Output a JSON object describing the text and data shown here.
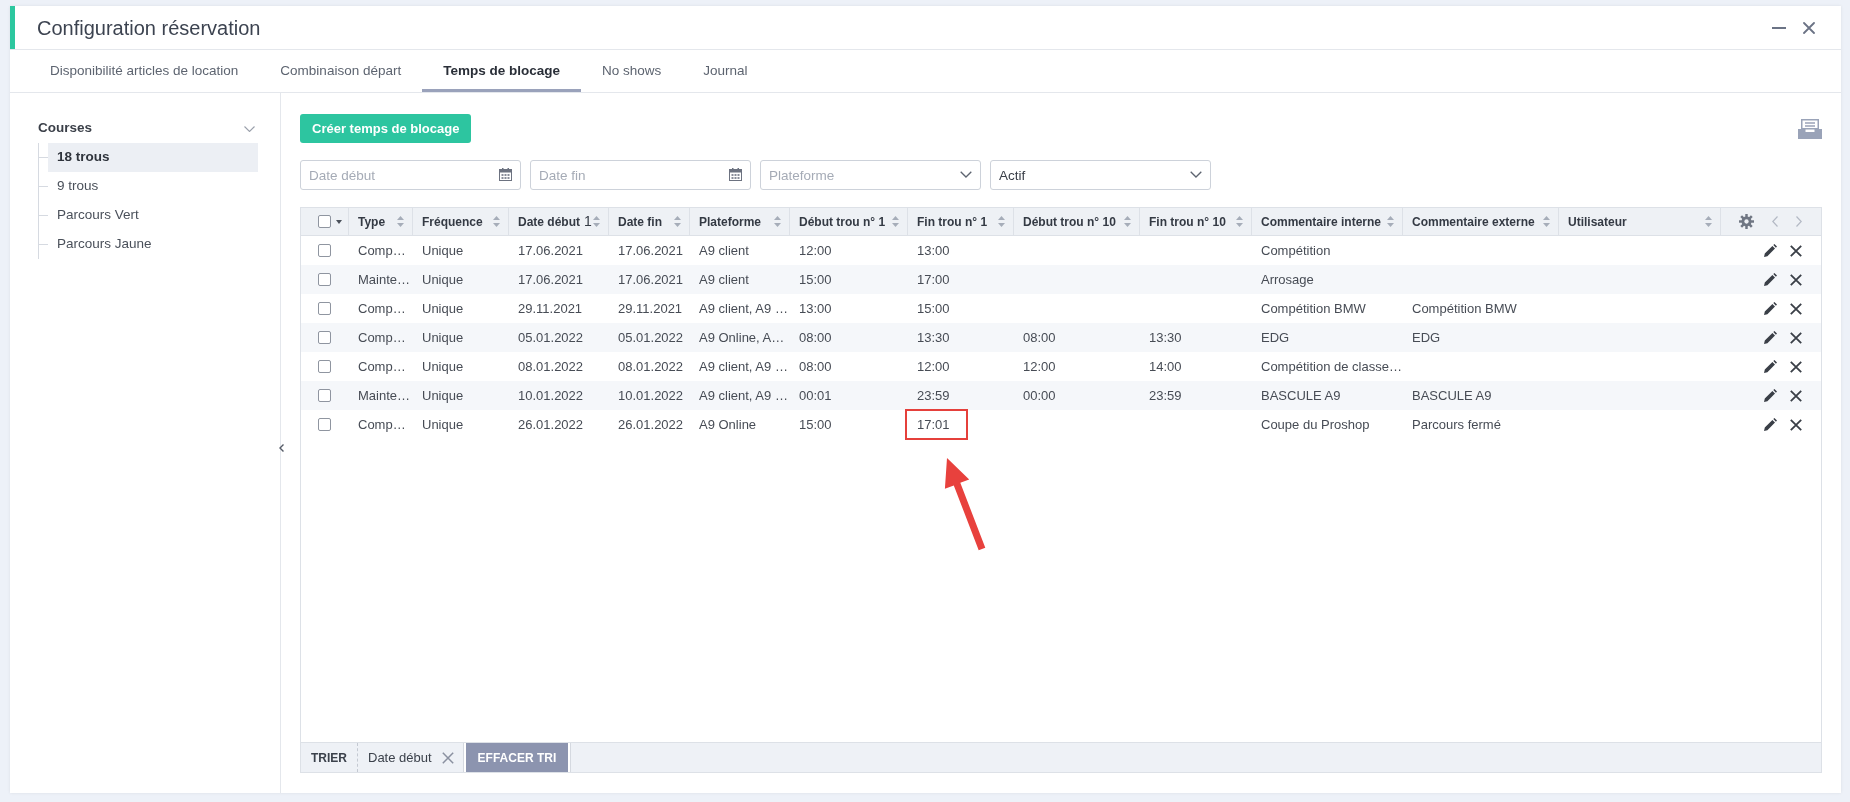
{
  "window": {
    "title": "Configuration réservation"
  },
  "tabs": [
    {
      "label": "Disponibilité articles de location",
      "selected": false
    },
    {
      "label": "Combinaison départ",
      "selected": false
    },
    {
      "label": "Temps de blocage",
      "selected": true
    },
    {
      "label": "No shows",
      "selected": false
    },
    {
      "label": "Journal",
      "selected": false
    }
  ],
  "sidebar": {
    "heading": "Courses",
    "expanded": true,
    "items": [
      {
        "label": "18 trous",
        "selected": true
      },
      {
        "label": "9 trous",
        "selected": false
      },
      {
        "label": "Parcours Vert",
        "selected": false
      },
      {
        "label": "Parcours Jaune",
        "selected": false
      }
    ]
  },
  "toolbar": {
    "create_button": "Créer temps de blocage"
  },
  "filters": [
    {
      "kind": "date",
      "placeholder": "Date début"
    },
    {
      "kind": "date",
      "placeholder": "Date fin"
    },
    {
      "kind": "select",
      "placeholder": "Plateforme"
    },
    {
      "kind": "select",
      "value": "Actif"
    }
  ],
  "table": {
    "select_all_checked": false,
    "columns": [
      {
        "label": "Type"
      },
      {
        "label": "Fréquence"
      },
      {
        "label": "Date début",
        "sort_order": "1"
      },
      {
        "label": "Date fin"
      },
      {
        "label": "Plateforme"
      },
      {
        "label": "Début trou n° 1"
      },
      {
        "label": "Fin trou n° 1"
      },
      {
        "label": "Début trou n° 10"
      },
      {
        "label": "Fin trou n° 10"
      },
      {
        "label": "Commentaire interne"
      },
      {
        "label": "Commentaire externe"
      },
      {
        "label": "Utilisateur"
      }
    ],
    "rows": [
      {
        "checked": false,
        "cells": [
          "Comp…",
          "Unique",
          "17.06.2021",
          "17.06.2021",
          "A9 client",
          "12:00",
          "13:00",
          null,
          null,
          "Compétition",
          null,
          null
        ]
      },
      {
        "checked": false,
        "cells": [
          "Mainte…",
          "Unique",
          "17.06.2021",
          "17.06.2021",
          "A9 client",
          "15:00",
          "17:00",
          null,
          null,
          "Arrosage",
          null,
          null
        ]
      },
      {
        "checked": false,
        "cells": [
          "Comp…",
          "Unique",
          "29.11.2021",
          "29.11.2021",
          "A9 client, A9 …",
          "13:00",
          "15:00",
          null,
          null,
          "Compétition BMW",
          "Compétition BMW",
          null
        ]
      },
      {
        "checked": false,
        "cells": [
          "Comp…",
          "Unique",
          "05.01.2022",
          "05.01.2022",
          "A9 Online, A…",
          "08:00",
          "13:30",
          "08:00",
          "13:30",
          "EDG",
          "EDG",
          null
        ]
      },
      {
        "checked": false,
        "cells": [
          "Comp…",
          "Unique",
          "08.01.2022",
          "08.01.2022",
          "A9 client, A9 …",
          "08:00",
          "12:00",
          "12:00",
          "14:00",
          "Compétition de classe…",
          null,
          null
        ]
      },
      {
        "checked": false,
        "cells": [
          "Mainte…",
          "Unique",
          "10.01.2022",
          "10.01.2022",
          "A9 client, A9 …",
          "00:01",
          "23:59",
          "00:00",
          "23:59",
          "BASCULE A9",
          "BASCULE A9",
          null
        ]
      },
      {
        "checked": false,
        "cells": [
          "Comp…",
          "Unique",
          "26.01.2022",
          "26.01.2022",
          "A9 Online",
          "15:00",
          "17:01",
          null,
          null,
          "Coupe du Proshop",
          "Parcours fermé",
          null
        ]
      }
    ]
  },
  "sort_bar": {
    "label": "TRIER",
    "chips": [
      {
        "label": "Date début"
      }
    ],
    "clear_button": "EFFACER TRI"
  }
}
